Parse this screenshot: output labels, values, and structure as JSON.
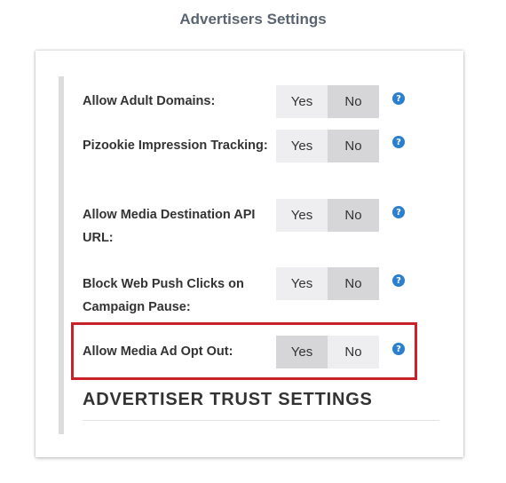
{
  "page": {
    "title": "Advertisers Settings"
  },
  "settings": [
    {
      "label": "Allow Adult Domains:",
      "yes": "Yes",
      "no": "No",
      "selected": "No",
      "help": "?"
    },
    {
      "label": "Pizookie Impression Tracking:",
      "yes": "Yes",
      "no": "No",
      "selected": "No",
      "help": "?"
    },
    {
      "label": "Allow Media Destination API URL:",
      "yes": "Yes",
      "no": "No",
      "selected": "No",
      "help": "?"
    },
    {
      "label": "Block Web Push Clicks on Campaign Pause:",
      "yes": "Yes",
      "no": "No",
      "selected": "No",
      "help": "?"
    },
    {
      "label": "Allow Media Ad Opt Out:",
      "yes": "Yes",
      "no": "No",
      "selected": "Yes",
      "help": "?"
    }
  ],
  "section": {
    "heading": "ADVERTISER TRUST SETTINGS"
  },
  "colors": {
    "highlight": "#c9202a",
    "help_icon": "#2a7fd0",
    "title": "#5b6472"
  }
}
